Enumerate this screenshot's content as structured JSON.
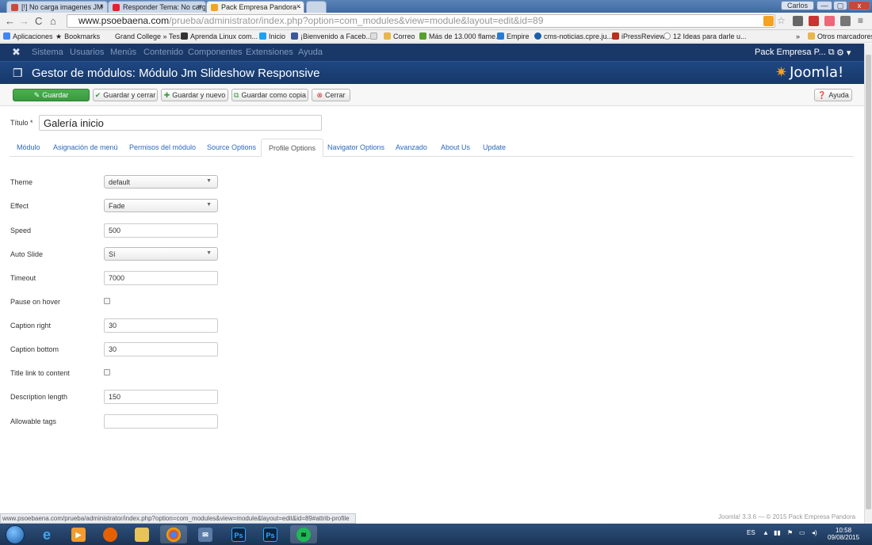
{
  "browser": {
    "tabs": [
      {
        "label": "[!] No carga imagenes JM",
        "color": "#d14836"
      },
      {
        "label": "Responder Tema: No carg",
        "color": "#e0252c"
      },
      {
        "label": "Pack Empresa Pandora - ",
        "color": "#f4a223"
      }
    ],
    "user": "Carlos",
    "window_buttons": [
      "—",
      "▢",
      "x"
    ],
    "url_host": "www.psoebaena.com",
    "url_path": "/prueba/administrator/index.php?option=com_modules&view=module&layout=edit&id=89",
    "bookmarks": [
      {
        "label": "Aplicaciones",
        "color": "#4285f4"
      },
      {
        "label": "Bookmarks",
        "color": "#555555"
      },
      {
        "label": "Grand College » Tes...",
        "color": "#ffffff"
      },
      {
        "label": "Aprenda Linux com...",
        "color": "#333333"
      },
      {
        "label": "Inicio",
        "color": "#1da1f2"
      },
      {
        "label": "¡Bienvenido a Faceb...",
        "color": "#3b5998"
      },
      {
        "label": "",
        "color": "#cccccc"
      },
      {
        "label": "Correo",
        "color": "#e8b64c"
      },
      {
        "label": "Más de 13.000 flame...",
        "color": "#5a9e2f"
      },
      {
        "label": "Empire",
        "color": "#2a7bd1"
      },
      {
        "label": "cms-noticias.cpre.ju...",
        "color": "#1a5ea8"
      },
      {
        "label": "iPressReview",
        "color": "#b8311c"
      },
      {
        "label": "12 Ideas para darle u...",
        "color": "#999999"
      }
    ],
    "other_bookmarks": "Otros marcadores",
    "status_url": "www.psoebaena.com/prueba/administrator/index.php?option=com_modules&view=module&layout=edit&id=89#attrib-profile"
  },
  "joomla": {
    "menu": [
      "Sistema",
      "Usuarios",
      "Menús",
      "Contenido",
      "Componentes",
      "Extensiones",
      "Ayuda"
    ],
    "site_name": "Pack Empresa P...",
    "page_title": "Gestor de módulos: Módulo Jm Slideshow Responsive",
    "brand": "Joomla!",
    "toolbar": {
      "save": "Guardar",
      "save_close": "Guardar y cerrar",
      "save_new": "Guardar y nuevo",
      "save_copy": "Guardar como copia",
      "close": "Cerrar",
      "help": "Ayuda"
    },
    "title_label": "Título *",
    "title_value": "Galería inicio",
    "tabs": [
      "Módulo",
      "Asignación de menú",
      "Permisos del módulo",
      "Source Options",
      "Profile Options",
      "Navigator Options",
      "Avanzado",
      "About Us",
      "Update"
    ],
    "active_tab": "Profile Options",
    "fields": {
      "theme": {
        "label": "Theme",
        "value": "default"
      },
      "effect": {
        "label": "Effect",
        "value": "Fade"
      },
      "speed": {
        "label": "Speed",
        "value": "500"
      },
      "auto_slide": {
        "label": "Auto Slide",
        "value": "Sí"
      },
      "timeout": {
        "label": "Timeout",
        "value": "7000"
      },
      "pause_on_hover": {
        "label": "Pause on hover"
      },
      "caption_right": {
        "label": "Caption right",
        "value": "30"
      },
      "caption_bottom": {
        "label": "Caption bottom",
        "value": "30"
      },
      "title_link": {
        "label": "Title link to content"
      },
      "description_length": {
        "label": "Description length",
        "value": "150"
      },
      "allowable_tags": {
        "label": "Allowable tags",
        "value": ""
      }
    },
    "footer": "Joomla! 3.3.6 — © 2015 Pack Empresa Pandora"
  },
  "taskbar": {
    "lang": "ES",
    "time": "10:58",
    "date": "09/08/2015"
  }
}
